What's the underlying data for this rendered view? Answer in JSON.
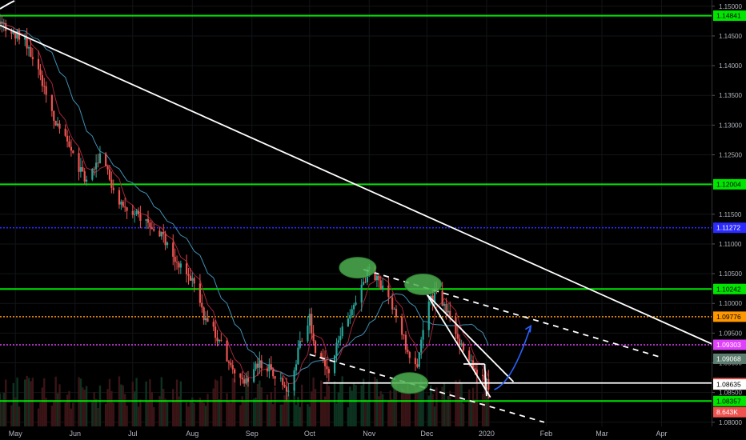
{
  "chart_data": {
    "type": "candlestick",
    "price_axis": {
      "min": 1.0793,
      "max": 1.15105,
      "ticks": [
        "1.15000",
        "1.14500",
        "1.14000",
        "1.13500",
        "1.13000",
        "1.12500",
        "1.12000",
        "1.11500",
        "1.11000",
        "1.10500",
        "1.10000",
        "1.09500",
        "1.09000",
        "1.08500",
        "1.08000"
      ]
    },
    "time_axis": {
      "start": "2019-04-23",
      "end": "2020-04-27",
      "ticks": [
        {
          "date": "2019-05-01",
          "label": "May"
        },
        {
          "date": "2019-06-01",
          "label": "Jun"
        },
        {
          "date": "2019-07-01",
          "label": "Jul"
        },
        {
          "date": "2019-08-01",
          "label": "Aug"
        },
        {
          "date": "2019-09-01",
          "label": "Sep"
        },
        {
          "date": "2019-10-01",
          "label": "Oct"
        },
        {
          "date": "2019-11-01",
          "label": "Nov"
        },
        {
          "date": "2019-12-01",
          "label": "Dec"
        },
        {
          "date": "2020-01-01",
          "label": "2020"
        },
        {
          "date": "2020-02-01",
          "label": "Feb"
        },
        {
          "date": "2020-03-01",
          "label": "Mar"
        },
        {
          "date": "2020-04-01",
          "label": "Apr"
        }
      ]
    },
    "price_path": [
      [
        "2019-04-23",
        1.147
      ],
      [
        "2019-05-06",
        1.1445
      ],
      [
        "2019-05-13",
        1.1395
      ],
      [
        "2019-05-20",
        1.1318
      ],
      [
        "2019-05-30",
        1.1255
      ],
      [
        "2019-06-06",
        1.121
      ],
      [
        "2019-06-14",
        1.1245
      ],
      [
        "2019-06-24",
        1.1175
      ],
      [
        "2019-07-01",
        1.115
      ],
      [
        "2019-07-10",
        1.1135
      ],
      [
        "2019-07-18",
        1.1105
      ],
      [
        "2019-07-26",
        1.106
      ],
      [
        "2019-08-01",
        1.104
      ],
      [
        "2019-08-07",
        1.098
      ],
      [
        "2019-08-14",
        1.0945
      ],
      [
        "2019-08-22",
        1.0885
      ],
      [
        "2019-08-30",
        1.087
      ],
      [
        "2019-09-04",
        1.09
      ],
      [
        "2019-09-12",
        1.0885
      ],
      [
        "2019-09-20",
        1.0855
      ],
      [
        "2019-09-26",
        1.093
      ],
      [
        "2019-10-01",
        1.0975
      ],
      [
        "2019-10-04",
        1.092
      ],
      [
        "2019-10-11",
        1.088
      ],
      [
        "2019-10-18",
        1.096
      ],
      [
        "2019-10-25",
        1.1005
      ],
      [
        "2019-11-01",
        1.106
      ],
      [
        "2019-11-08",
        1.1025
      ],
      [
        "2019-11-14",
        1.099
      ],
      [
        "2019-11-20",
        1.093
      ],
      [
        "2019-11-26",
        1.089
      ],
      [
        "2019-12-01",
        1.0995
      ],
      [
        "2019-12-06",
        1.102
      ],
      [
        "2019-12-12",
        1.0985
      ],
      [
        "2019-12-18",
        1.0935
      ],
      [
        "2019-12-23",
        1.09
      ],
      [
        "2019-12-27",
        1.0885
      ],
      [
        "2020-01-02",
        1.0862
      ]
    ],
    "horizontal_levels": [
      {
        "value": 1.14841,
        "label": "1.14841",
        "color": "#00e600",
        "style": "solid"
      },
      {
        "value": 1.12004,
        "label": "1.12004",
        "color": "#00e600",
        "style": "solid"
      },
      {
        "value": 1.11272,
        "label": "1.11272",
        "color": "#2b2bff",
        "style": "dotted"
      },
      {
        "value": 1.10242,
        "label": "1.10242",
        "color": "#00e600",
        "style": "solid"
      },
      {
        "value": 1.09776,
        "label": "1.09776",
        "color": "#ff9800",
        "style": "dotted"
      },
      {
        "value": 1.09303,
        "label": "1.09303",
        "color": "#e040fb",
        "style": "dotted"
      },
      {
        "value": 1.08357,
        "label": "1.08357",
        "color": "#00e600",
        "style": "solid"
      }
    ],
    "price_labels": [
      {
        "value": 1.09068,
        "label": "1.09068",
        "color": "#5b7c6e"
      },
      {
        "value": 1.08659,
        "label": "1.08659",
        "color": "#ef5350"
      },
      {
        "value": 1.08635,
        "label": "1.08635",
        "color": "#ffffff"
      },
      {
        "value": 1.08357,
        "label": "1.08357",
        "color": "#00e600"
      },
      {
        "value": 1.0817,
        "label": "8.643K",
        "color": "#ef5350"
      }
    ],
    "trendlines": [
      {
        "from": [
          "2019-04-23",
          1.1468
        ],
        "to": [
          "2020-04-27",
          1.0932
        ],
        "color": "#ffffff",
        "style": "solid"
      },
      {
        "from": [
          "2019-10-29",
          1.1057
        ],
        "to": [
          "2020-03-31",
          1.091
        ],
        "color": "#ffffff",
        "style": "dashed"
      },
      {
        "from": [
          "2019-10-01",
          1.0914
        ],
        "to": [
          "2020-01-31",
          1.08
        ],
        "color": "#ffffff",
        "style": "dashed"
      },
      {
        "from": [
          "2019-12-01",
          1.1015
        ],
        "to": [
          "2020-01-15",
          1.0868
        ],
        "color": "#ffffff",
        "style": "solid"
      },
      {
        "from": [
          "2019-12-01",
          1.1015
        ],
        "to": [
          "2020-01-03",
          1.0842
        ],
        "color": "#ffffff",
        "style": "solid"
      },
      {
        "from": [
          "2019-10-08",
          1.0866
        ],
        "to": [
          "2020-04-27",
          1.0866
        ],
        "color": "#ffffff",
        "style": "solid"
      },
      {
        "from": [
          "2019-12-20",
          1.0898
        ],
        "to": [
          "2019-12-31",
          1.0898
        ],
        "color": "#ffffff",
        "style": "solid"
      },
      {
        "from": [
          "2019-12-31",
          1.0898
        ],
        "to": [
          "2020-01-01",
          1.0844
        ],
        "color": "#ffffff",
        "style": "solid"
      }
    ],
    "highlight_ellipses": [
      {
        "date": "2019-10-26",
        "value": 1.106
      },
      {
        "date": "2019-11-22",
        "value": 1.0866
      },
      {
        "date": "2019-11-29",
        "value": 1.1032
      }
    ],
    "projection_arrow": {
      "from": [
        "2020-01-05",
        1.0855
      ],
      "to": [
        "2020-01-24",
        1.0962
      ],
      "color": "#2962ff"
    }
  }
}
